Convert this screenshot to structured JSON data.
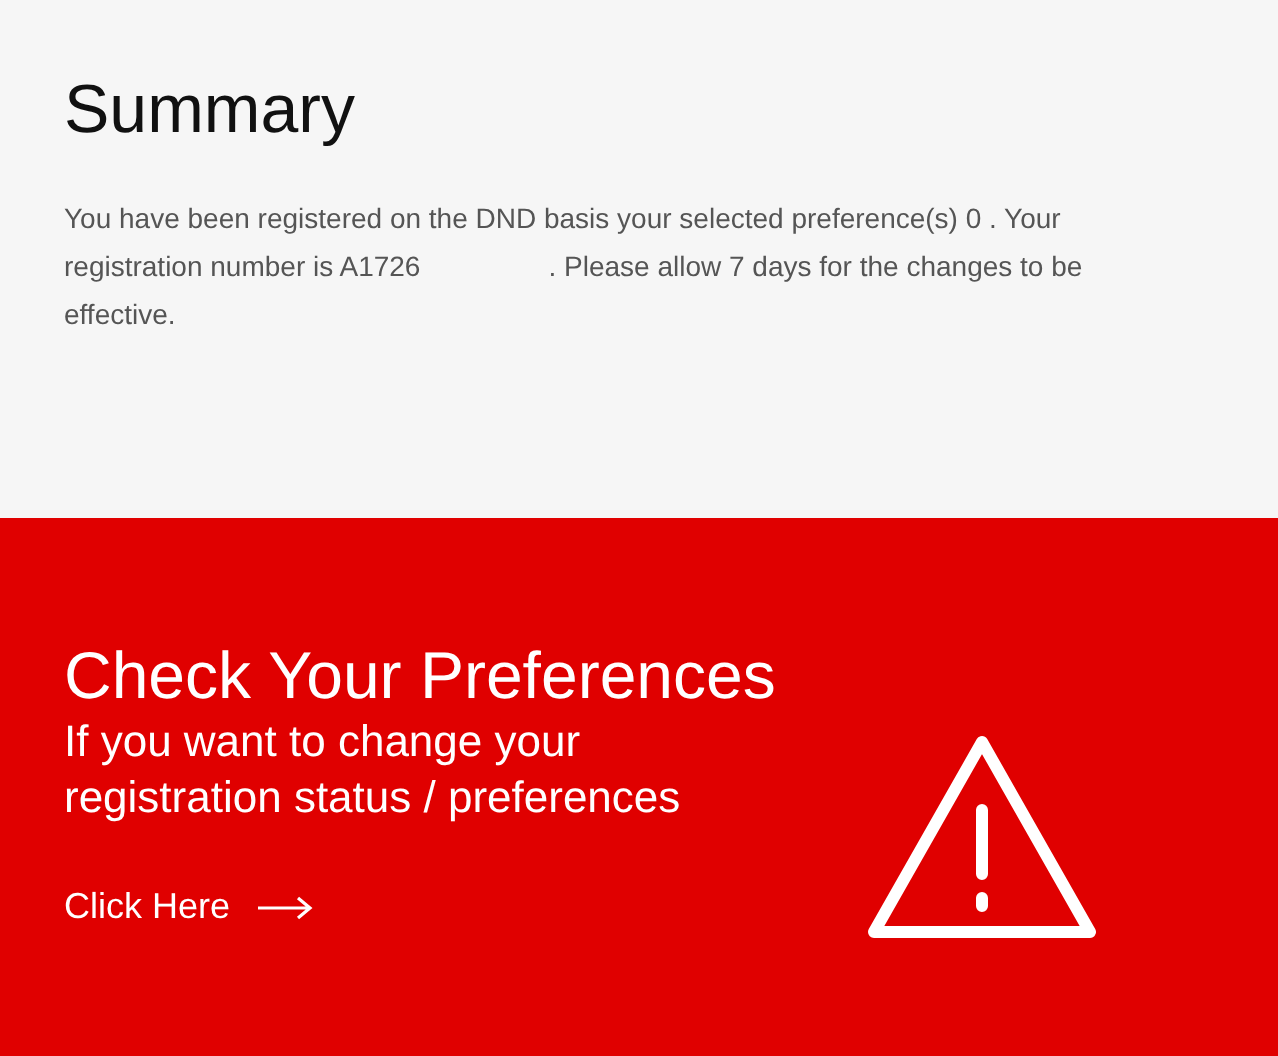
{
  "summary": {
    "title": "Summary",
    "text_parts": [
      "You have been registered on the DND basis your selected preference(s) 0 . Your registration number is A1726",
      ". Please allow 7 days for the changes to be effective."
    ]
  },
  "banner": {
    "title": "Check Your Preferences",
    "subtitle": "If you want to change your registration status / preferences",
    "link": "Click Here"
  }
}
